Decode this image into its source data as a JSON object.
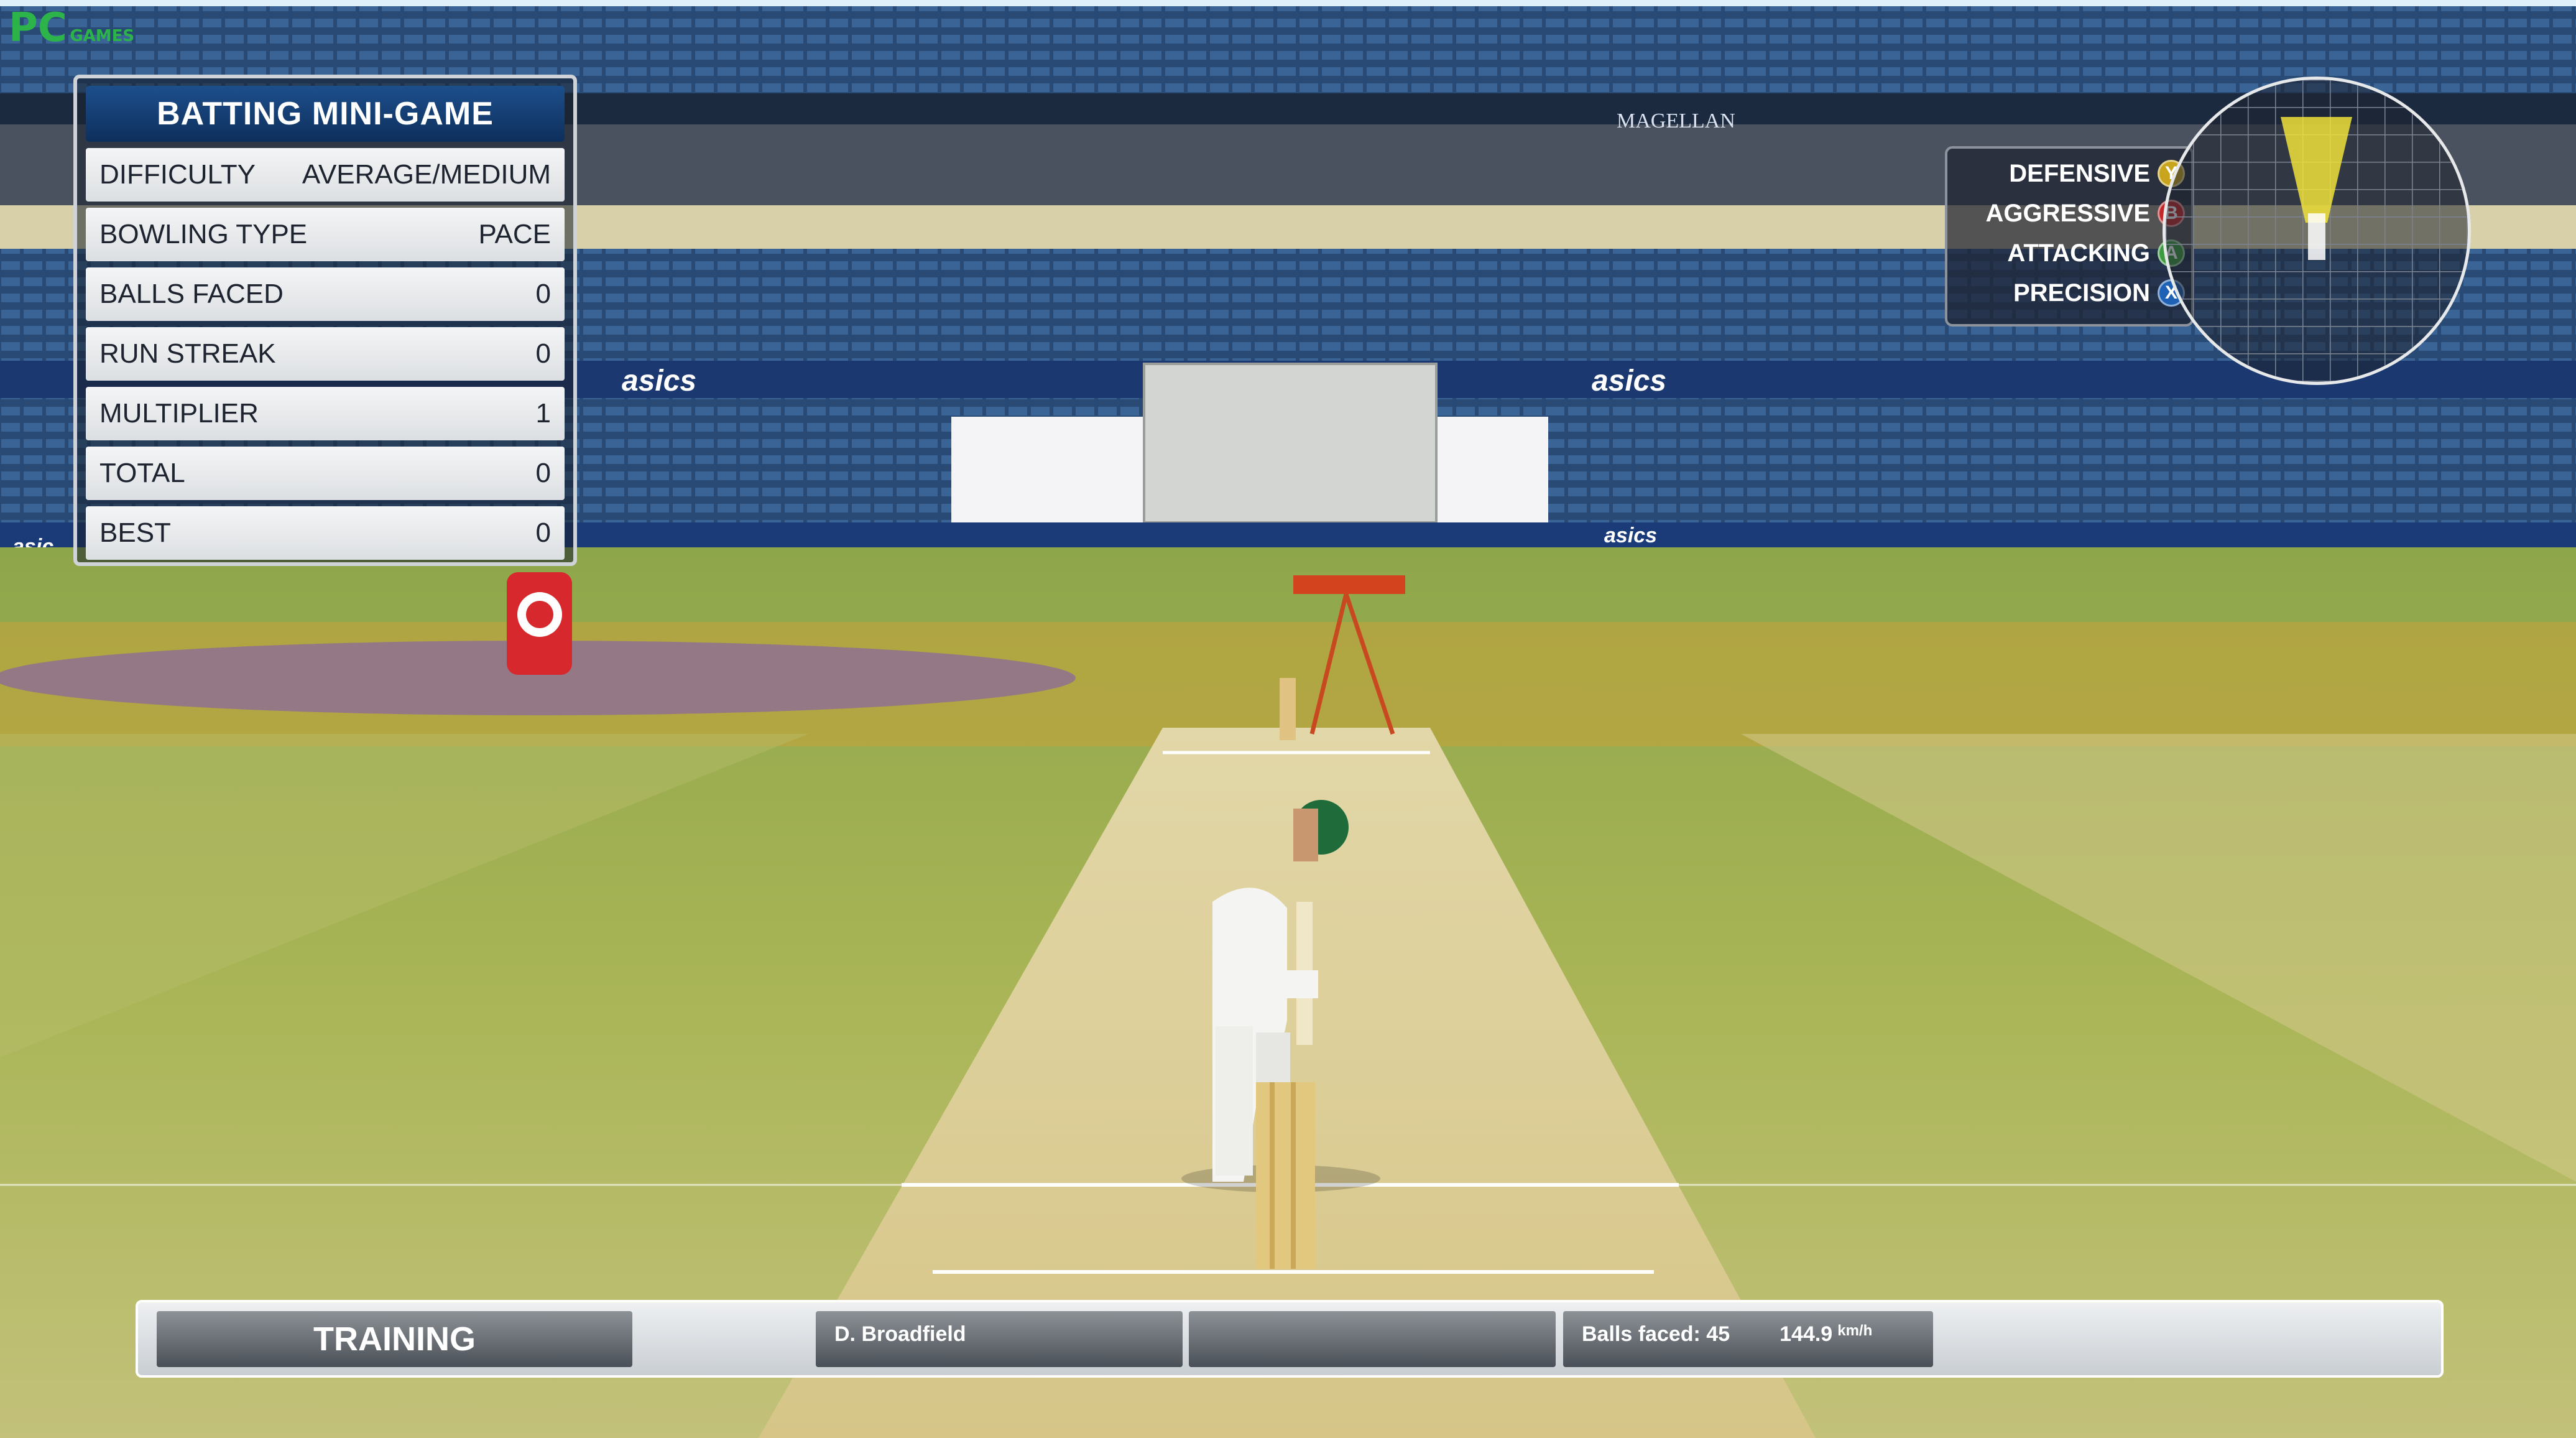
{
  "logo": {
    "main": "PC",
    "sub": "GAMES",
    "color": "#2cb34a"
  },
  "batting_panel": {
    "title": "BATTING MINI-GAME",
    "rows": [
      {
        "label": "DIFFICULTY",
        "value": "AVERAGE/MEDIUM"
      },
      {
        "label": "BOWLING TYPE",
        "value": "PACE"
      },
      {
        "label": "BALLS FACED",
        "value": "0"
      },
      {
        "label": "RUN STREAK",
        "value": "0"
      },
      {
        "label": "MULTIPLIER",
        "value": "1"
      },
      {
        "label": "TOTAL",
        "value": "0"
      },
      {
        "label": "BEST",
        "value": "0"
      }
    ]
  },
  "shot_modes": [
    {
      "label": "DEFENSIVE",
      "button": "Y",
      "color": "#c9a51e"
    },
    {
      "label": "AGGRESSIVE",
      "button": "B",
      "color": "#c2282b"
    },
    {
      "label": "ATTACKING",
      "button": "A",
      "color": "#3d9a3e"
    },
    {
      "label": "PRECISION",
      "button": "X",
      "color": "#1f62b5"
    }
  ],
  "stadium": {
    "sponsor_1": "MAGELLAN",
    "sponsor_2": "asics",
    "sponsor_2_small": "asic"
  },
  "bottom_bar": {
    "mode": "TRAINING",
    "batter": "D. Broadfield",
    "balls_faced": "Balls faced: 45",
    "speed": "144.9",
    "speed_unit": "km/h"
  },
  "colors": {
    "sky": "#cfe7f5",
    "seats": "#2c4d78",
    "grass_light": "#b4bd62",
    "grass_dark": "#8ea64a",
    "pitch": "#dccf9a",
    "zone_purple": "#8f6d96",
    "zone_orange": "#d4a033",
    "player_kit": "#f4f4f2",
    "helmet": "#1f6b3a"
  }
}
